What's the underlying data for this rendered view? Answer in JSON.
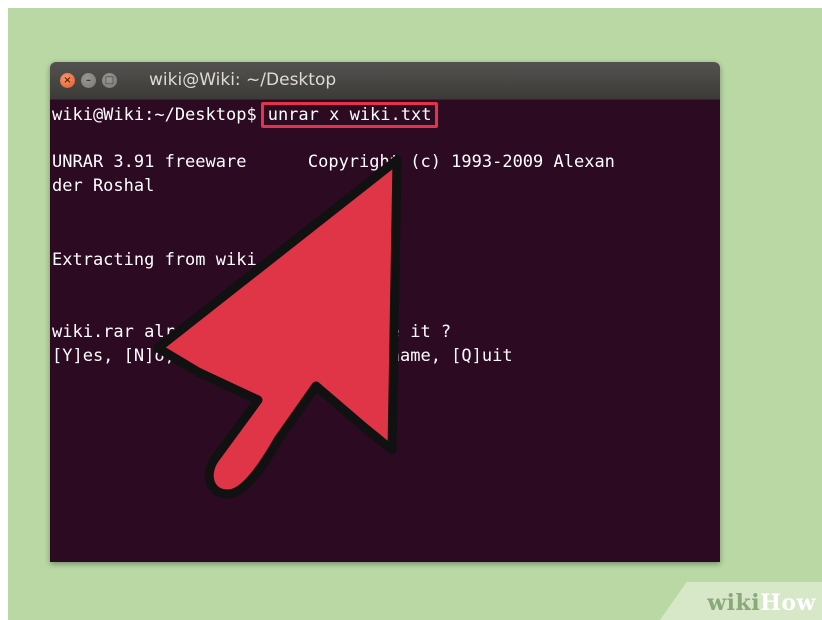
{
  "window": {
    "title": "wiki@Wiki: ~/Desktop",
    "buttons": {
      "close": "×",
      "minimize": "–",
      "maximize": "□"
    }
  },
  "terminal": {
    "prompt": "wiki@Wiki:~/Desktop$",
    "command": "unrar x wiki.txt",
    "output": [
      "UNRAR 3.91 freeware      Copyright (c) 1993-2009 Alexan",
      "der Roshal",
      "Extracting from wiki.rar",
      "wiki.rar already exists. Overwrite it ?",
      "[Y]es, [N]o, [A]ll, n[E]ver, [R]ename, [Q]uit"
    ]
  },
  "annotation": {
    "arrow_color": "#e03447",
    "outline_color": "#111111",
    "highlight_color": "#e3334a"
  },
  "watermark": {
    "wiki": "wiki",
    "how": "How"
  }
}
